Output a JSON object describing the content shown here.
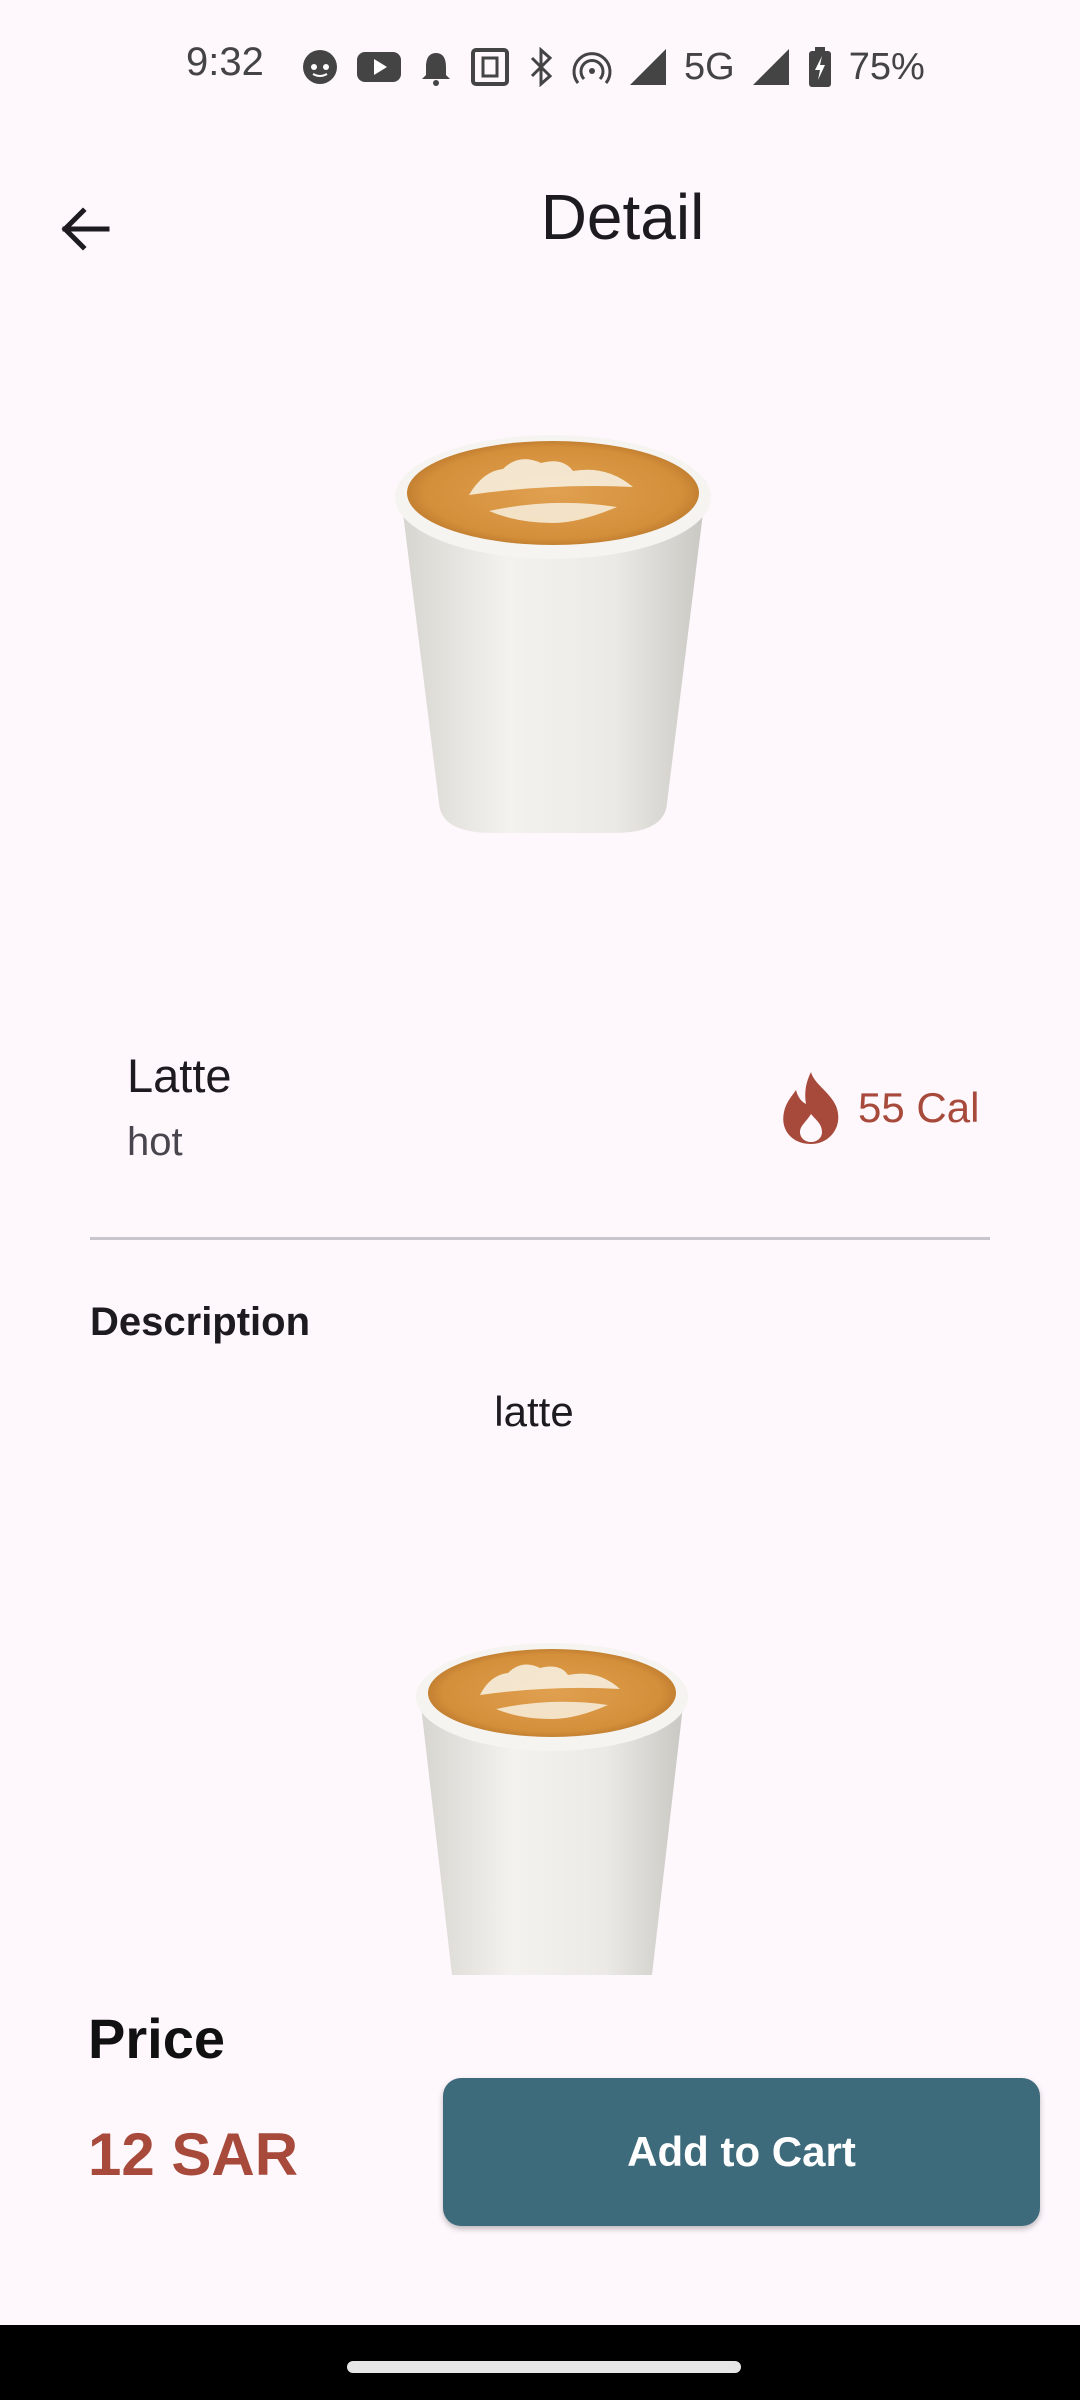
{
  "status_bar": {
    "time": "9:32",
    "network": "5G",
    "battery": "75%",
    "icons": [
      "face-icon",
      "youtube-icon",
      "notification-bell-icon",
      "nfc-icon",
      "bluetooth-icon",
      "hotspot-icon",
      "signal-icon",
      "signal-icon",
      "battery-charging-icon"
    ]
  },
  "app_bar": {
    "title": "Detail",
    "back_icon": "arrow-back-icon"
  },
  "product": {
    "name": "Latte",
    "variant": "hot",
    "calories": "55 Cal",
    "calories_icon": "flame-icon",
    "description_title": "Description",
    "description": "latte"
  },
  "footer": {
    "price_label": "Price",
    "price": "12 SAR",
    "add_to_cart_label": "Add to Cart"
  },
  "colors": {
    "background": "#FEF7FC",
    "accent": "#A74A3B",
    "button": "#3E6B7C"
  }
}
